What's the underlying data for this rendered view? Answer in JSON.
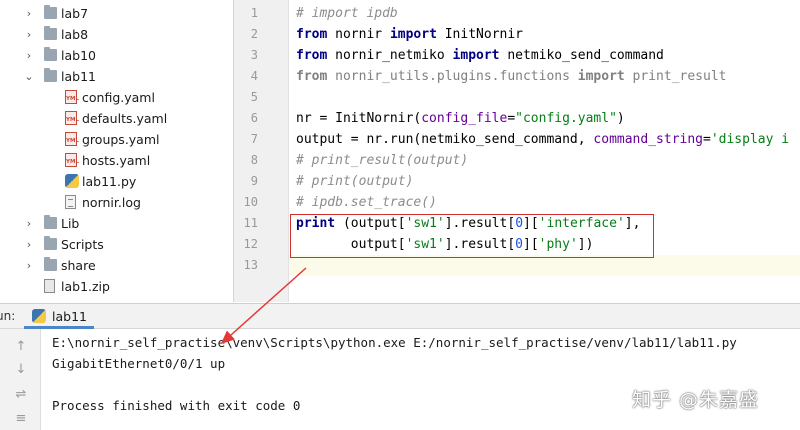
{
  "tree": [
    {
      "name": "lab7",
      "type": "folder",
      "level": 0
    },
    {
      "name": "lab8",
      "type": "folder",
      "level": 0
    },
    {
      "name": "lab10",
      "type": "folder",
      "level": 0
    },
    {
      "name": "lab11",
      "type": "folder",
      "level": 0,
      "expanded": true
    },
    {
      "name": "config.yaml",
      "type": "yaml",
      "level": 1
    },
    {
      "name": "defaults.yaml",
      "type": "yaml",
      "level": 1
    },
    {
      "name": "groups.yaml",
      "type": "yaml",
      "level": 1
    },
    {
      "name": "hosts.yaml",
      "type": "yaml",
      "level": 1
    },
    {
      "name": "lab11.py",
      "type": "python",
      "level": 1
    },
    {
      "name": "nornir.log",
      "type": "log",
      "level": 1
    },
    {
      "name": "Lib",
      "type": "folder",
      "level": 0
    },
    {
      "name": "Scripts",
      "type": "folder",
      "level": 0
    },
    {
      "name": "share",
      "type": "folder",
      "level": 0
    },
    {
      "name": "lab1.zip",
      "type": "zip",
      "level": 0
    }
  ],
  "icons": {
    "yaml_badge": "YML",
    "folder": "folder-icon",
    "python": "python-file-icon",
    "log": "log-file-icon",
    "zip": "zip-file-icon"
  },
  "editor": {
    "line_numbers": [
      "1",
      "2",
      "3",
      "4",
      "5",
      "6",
      "7",
      "8",
      "9",
      "10",
      "11",
      "12",
      "13"
    ],
    "lines": [
      [
        {
          "t": "# import ipdb",
          "c": "cm"
        }
      ],
      [
        {
          "t": "from",
          "c": "kw"
        },
        {
          "t": " nornir "
        },
        {
          "t": "import",
          "c": "kw"
        },
        {
          "t": " InitNornir"
        }
      ],
      [
        {
          "t": "from",
          "c": "kw"
        },
        {
          "t": " nornir_netmiko "
        },
        {
          "t": "import",
          "c": "kw"
        },
        {
          "t": " netmiko_send_command"
        }
      ],
      [
        {
          "t": "from",
          "c": "kw gray"
        },
        {
          "t": " nornir_utils.plugins.functions ",
          "c": "gray"
        },
        {
          "t": "import",
          "c": "kw gray"
        },
        {
          "t": " print_result",
          "c": "gray"
        }
      ],
      [],
      [
        {
          "t": "nr = InitNornir("
        },
        {
          "t": "config_file",
          "c": "par"
        },
        {
          "t": "="
        },
        {
          "t": "\"config.yaml\"",
          "c": "str"
        },
        {
          "t": ")"
        }
      ],
      [
        {
          "t": "output = nr.run(netmiko_send_command, "
        },
        {
          "t": "command_string",
          "c": "par"
        },
        {
          "t": "="
        },
        {
          "t": "'display i",
          "c": "str"
        }
      ],
      [
        {
          "t": "# print_result(output)",
          "c": "cm"
        }
      ],
      [
        {
          "t": "# print(output)",
          "c": "cm"
        }
      ],
      [
        {
          "t": "# ipdb.set_trace()",
          "c": "cm"
        }
      ],
      [
        {
          "t": "print",
          "c": "kw"
        },
        {
          "t": " (output["
        },
        {
          "t": "'sw1'",
          "c": "str"
        },
        {
          "t": "].result["
        },
        {
          "t": "0",
          "c": "num"
        },
        {
          "t": "]["
        },
        {
          "t": "'interface'",
          "c": "str"
        },
        {
          "t": "],"
        }
      ],
      [
        {
          "t": "       output["
        },
        {
          "t": "'sw1'",
          "c": "str"
        },
        {
          "t": "].result["
        },
        {
          "t": "0",
          "c": "num"
        },
        {
          "t": "]["
        },
        {
          "t": "'phy'",
          "c": "str"
        },
        {
          "t": "])"
        }
      ],
      []
    ]
  },
  "run": {
    "side_label": "un:",
    "tab_label": "lab11",
    "console": [
      "E:\\nornir_self_practise\\venv\\Scripts\\python.exe E:/nornir_self_practise/venv/lab11/lab11.py",
      "GigabitEthernet0/0/1 up",
      "",
      "Process finished with exit code 0"
    ]
  },
  "watermark": "知乎 @朱嘉盛",
  "colors": {
    "highlight_box": "#d32f2f",
    "tab_underline": "#4a86c8"
  }
}
